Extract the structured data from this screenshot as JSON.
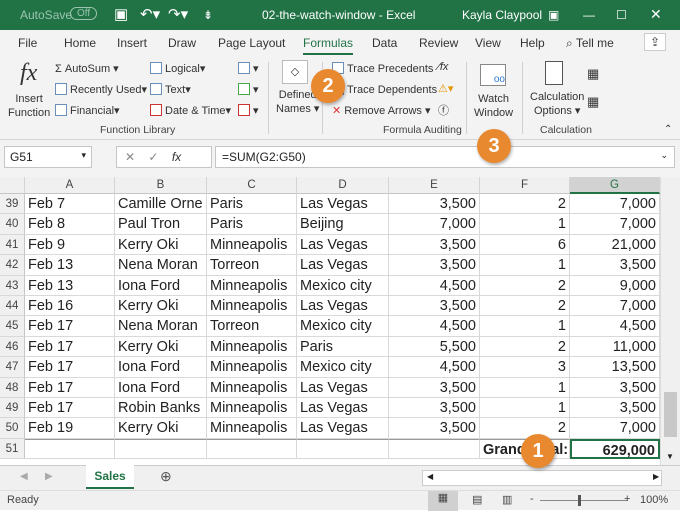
{
  "titlebar": {
    "autosave": "AutoSave",
    "autosave_state": "Off",
    "filename": "02-the-watch-window",
    "app": "Excel",
    "user": "Kayla Claypool"
  },
  "tabs": [
    "File",
    "Home",
    "Insert",
    "Draw",
    "Page Layout",
    "Formulas",
    "Data",
    "Review",
    "View",
    "Help",
    "Tell me"
  ],
  "ribbon": {
    "insert_function": [
      "Insert",
      "Function"
    ],
    "autosum": "AutoSum",
    "recently_used": "Recently Used",
    "financial": "Financial",
    "logical": "Logical",
    "text": "Text",
    "date_time": "Date & Time",
    "defined_names": [
      "Defined",
      "Names"
    ],
    "trace_precedents": "Trace Precedents",
    "trace_dependents": "Trace Dependents",
    "remove_arrows": "Remove Arrows",
    "watch_window": [
      "Watch",
      "Window"
    ],
    "calc_options": [
      "Calculation",
      "Options"
    ],
    "groups": {
      "function_library": "Function Library",
      "formula_auditing": "Formula Auditing",
      "calculation": "Calculation"
    }
  },
  "formula_bar": {
    "name_box": "G51",
    "formula": "=SUM(G2:G50)"
  },
  "columns": [
    "A",
    "B",
    "C",
    "D",
    "E",
    "F",
    "G"
  ],
  "rows": [
    {
      "n": "39",
      "cells": [
        "Feb 7",
        "Camille Orne",
        "Paris",
        "Las Vegas",
        "3,500",
        "2",
        "7,000"
      ]
    },
    {
      "n": "40",
      "cells": [
        "Feb 8",
        "Paul Tron",
        "Paris",
        "Beijing",
        "7,000",
        "1",
        "7,000"
      ]
    },
    {
      "n": "41",
      "cells": [
        "Feb 9",
        "Kerry Oki",
        "Minneapolis",
        "Las Vegas",
        "3,500",
        "6",
        "21,000"
      ]
    },
    {
      "n": "42",
      "cells": [
        "Feb 13",
        "Nena Moran",
        "Torreon",
        "Las Vegas",
        "3,500",
        "1",
        "3,500"
      ]
    },
    {
      "n": "43",
      "cells": [
        "Feb 13",
        "Iona Ford",
        "Minneapolis",
        "Mexico city",
        "4,500",
        "2",
        "9,000"
      ]
    },
    {
      "n": "44",
      "cells": [
        "Feb 16",
        "Kerry Oki",
        "Minneapolis",
        "Las Vegas",
        "3,500",
        "2",
        "7,000"
      ]
    },
    {
      "n": "45",
      "cells": [
        "Feb 17",
        "Nena Moran",
        "Torreon",
        "Mexico city",
        "4,500",
        "1",
        "4,500"
      ]
    },
    {
      "n": "46",
      "cells": [
        "Feb 17",
        "Kerry Oki",
        "Minneapolis",
        "Paris",
        "5,500",
        "2",
        "11,000"
      ]
    },
    {
      "n": "47",
      "cells": [
        "Feb 17",
        "Iona Ford",
        "Minneapolis",
        "Mexico city",
        "4,500",
        "3",
        "13,500"
      ]
    },
    {
      "n": "48",
      "cells": [
        "Feb 17",
        "Iona Ford",
        "Minneapolis",
        "Las Vegas",
        "3,500",
        "1",
        "3,500"
      ]
    },
    {
      "n": "49",
      "cells": [
        "Feb 17",
        "Robin Banks",
        "Minneapolis",
        "Las Vegas",
        "3,500",
        "1",
        "3,500"
      ]
    },
    {
      "n": "50",
      "cells": [
        "Feb 19",
        "Kerry Oki",
        "Minneapolis",
        "Las Vegas",
        "3,500",
        "2",
        "7,000"
      ]
    },
    {
      "n": "51",
      "cells": [
        "",
        "",
        "",
        "",
        "",
        "Grand Total:",
        "629,000"
      ]
    }
  ],
  "sheet_tab": "Sales",
  "status": {
    "ready": "Ready",
    "zoom": "100%"
  },
  "callouts": [
    "1",
    "2",
    "3"
  ],
  "colors": {
    "accent": "#217346",
    "callout": "#e8892f"
  }
}
